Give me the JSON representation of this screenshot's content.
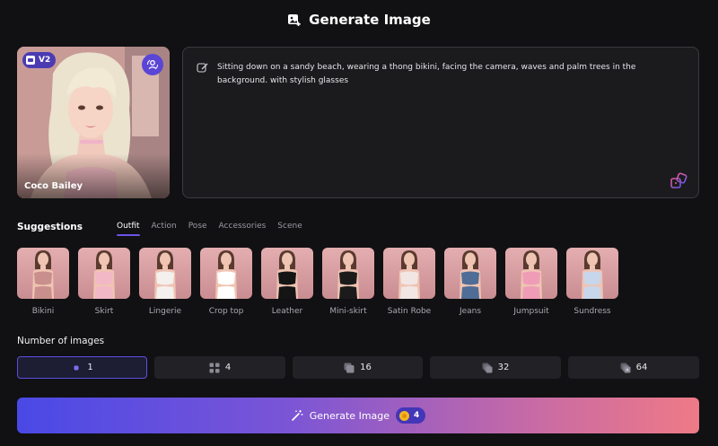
{
  "header": {
    "title": "Generate Image",
    "icon": "image-plus-icon"
  },
  "character": {
    "name": "Coco Bailey",
    "version": "V2",
    "swap_icon": "swap-character-icon"
  },
  "prompt": {
    "text": "Sitting down on a sandy beach, wearing a thong bikini, facing the camera, waves and palm trees in the background. with stylish glasses"
  },
  "suggestions": {
    "title": "Suggestions",
    "tabs": [
      {
        "label": "Outfit",
        "active": true
      },
      {
        "label": "Action",
        "active": false
      },
      {
        "label": "Pose",
        "active": false
      },
      {
        "label": "Accessories",
        "active": false
      },
      {
        "label": "Scene",
        "active": false
      }
    ],
    "outfits": [
      {
        "label": "Bikini",
        "color": "#c98f8c"
      },
      {
        "label": "Skirt",
        "color": "#f2b8c6"
      },
      {
        "label": "Lingerie",
        "color": "#f4f0ee"
      },
      {
        "label": "Crop top",
        "color": "#ffffff"
      },
      {
        "label": "Leather",
        "color": "#151515"
      },
      {
        "label": "Mini-skirt",
        "color": "#1b1b1b"
      },
      {
        "label": "Satin Robe",
        "color": "#f1e6e4"
      },
      {
        "label": "Jeans",
        "color": "#4f6d96"
      },
      {
        "label": "Jumpsuit",
        "color": "#ef9db6"
      },
      {
        "label": "Sundress",
        "color": "#c7d6ea"
      }
    ]
  },
  "number_of_images": {
    "title": "Number of images",
    "options": [
      {
        "value": "1",
        "icon": "single-dot-icon",
        "selected": true
      },
      {
        "value": "4",
        "icon": "grid-four-icon",
        "selected": false
      },
      {
        "value": "16",
        "icon": "stack-icon",
        "selected": false
      },
      {
        "value": "32",
        "icon": "stack-double-icon",
        "selected": false
      },
      {
        "value": "64",
        "icon": "stack-many-icon",
        "selected": false
      }
    ]
  },
  "generate": {
    "label": "Generate Image",
    "cost": "4",
    "icon": "magic-wand-icon"
  },
  "colors": {
    "accent": "#5c4fe0",
    "background": "#111113"
  }
}
